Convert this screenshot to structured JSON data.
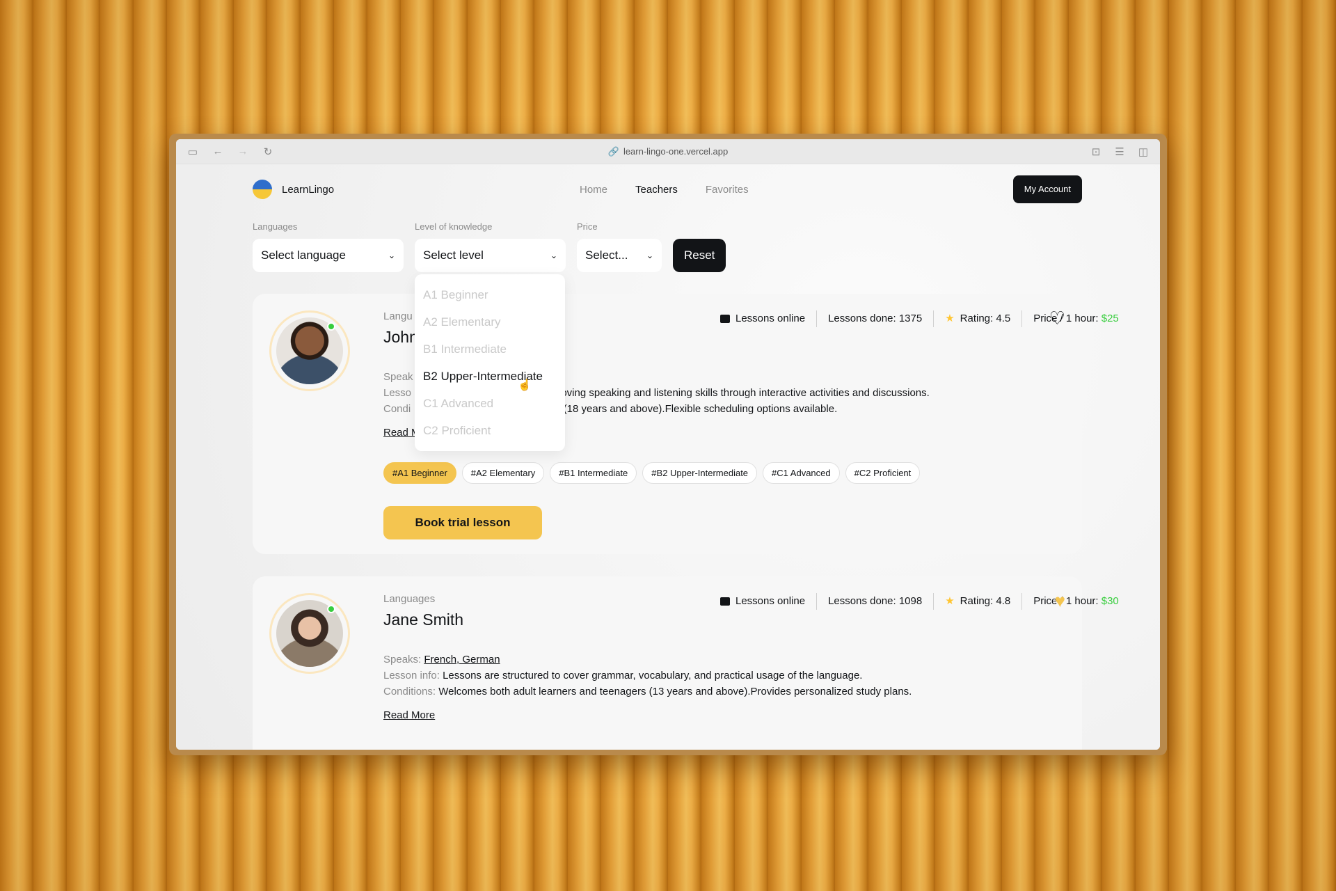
{
  "browser": {
    "url": "learn-lingo-one.vercel.app"
  },
  "header": {
    "logo_text": "LearnLingo",
    "nav": [
      {
        "label": "Home",
        "active": false
      },
      {
        "label": "Teachers",
        "active": true
      },
      {
        "label": "Favorites",
        "active": false
      }
    ],
    "account_button": "My Account"
  },
  "filters": {
    "languages": {
      "label": "Languages",
      "value": "Select language"
    },
    "level": {
      "label": "Level of knowledge",
      "value": "Select level"
    },
    "price": {
      "label": "Price",
      "value": "Select..."
    },
    "reset": "Reset",
    "level_options": [
      {
        "label": "A1 Beginner",
        "hovered": false
      },
      {
        "label": "A2 Elementary",
        "hovered": false
      },
      {
        "label": "B1 Intermediate",
        "hovered": false
      },
      {
        "label": "B2 Upper-Intermediate",
        "hovered": true
      },
      {
        "label": "C1 Advanced",
        "hovered": false
      },
      {
        "label": "C2 Proficient",
        "hovered": false
      }
    ]
  },
  "teachers": [
    {
      "languages_label": "Langu",
      "name": "John",
      "lessons_online": "Lessons online",
      "lessons_done": "Lessons done: 1375",
      "rating": "Rating: 4.5",
      "price_label": "Price / 1 hour: ",
      "price_value": "$25",
      "favorite": false,
      "speaks_label": "Speak",
      "lesson_info_label": "Lesso",
      "lesson_info": "proving speaking and listening skills through interactive activities and discussions.",
      "conditions_label": "Condi",
      "conditions": "rs (18 years and above).Flexible scheduling options available.",
      "read_more": "Read M",
      "tags": [
        "#A1 Beginner",
        "#A2 Elementary",
        "#B1 Intermediate",
        "#B2 Upper-Intermediate",
        "#C1 Advanced",
        "#C2 Proficient"
      ],
      "book_button": "Book trial lesson"
    },
    {
      "languages_label": "Languages",
      "name": "Jane Smith",
      "lessons_online": "Lessons online",
      "lessons_done": "Lessons done: 1098",
      "rating": "Rating: 4.8",
      "price_label": "Price / 1 hour: ",
      "price_value": "$30",
      "favorite": true,
      "speaks_label": "Speaks: ",
      "speaks": "French, German",
      "lesson_info_label": "Lesson info: ",
      "lesson_info": "Lessons are structured to cover grammar, vocabulary, and practical usage of the language.",
      "conditions_label": "Conditions: ",
      "conditions": "Welcomes both adult learners and teenagers (13 years and above).Provides personalized study plans.",
      "read_more": "Read More"
    }
  ],
  "colors": {
    "accent": "#f4c550",
    "dark": "#121417",
    "price_green": "#38cd3e",
    "muted": "#8a8a8a"
  }
}
